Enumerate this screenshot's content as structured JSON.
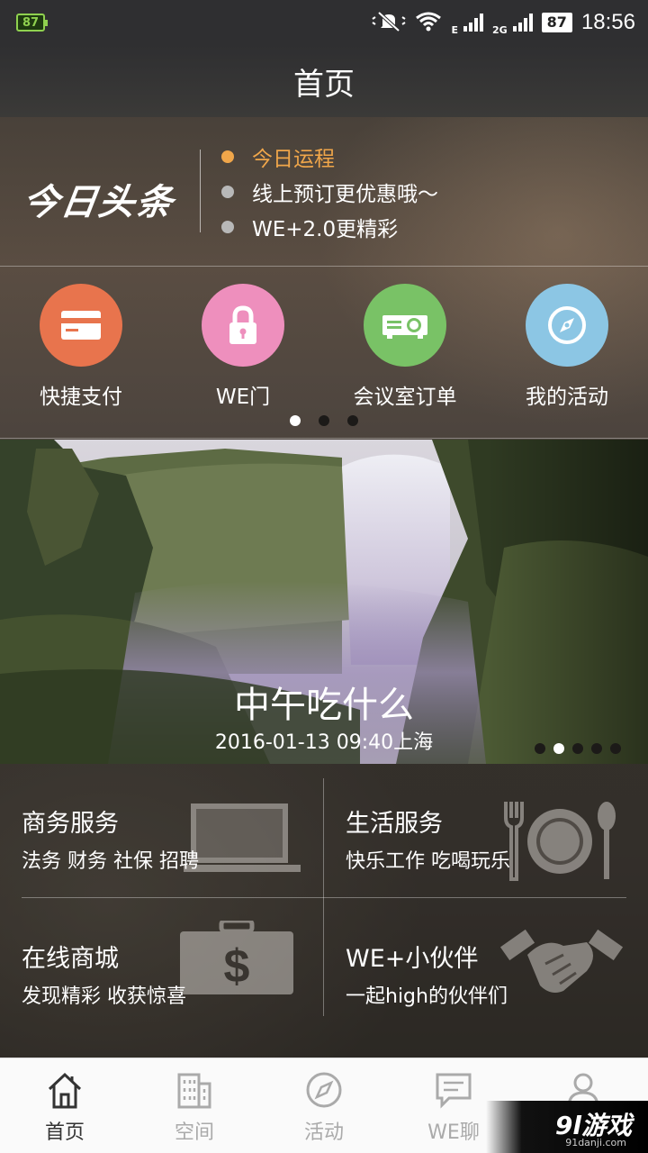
{
  "status_bar": {
    "left_badge": "87",
    "network_1": "E",
    "network_2": "2G",
    "battery": "87",
    "time": "18:56",
    "icons": [
      "battery-saver-icon",
      "mute-icon",
      "wifi-icon",
      "signal-icon",
      "signal-icon"
    ]
  },
  "header": {
    "title": "首页"
  },
  "headline": {
    "logo": "今日头条",
    "items": [
      {
        "label": "今日运程",
        "active": true
      },
      {
        "label": "线上预订更优惠哦～",
        "active": false
      },
      {
        "label": "WE+2.0更精彩",
        "active": false
      }
    ],
    "active_color": "#f0a64a"
  },
  "quick_actions": {
    "items": [
      {
        "label": "快捷支付",
        "icon": "card-icon",
        "color": "#e8744d"
      },
      {
        "label": "WE门",
        "icon": "lock-icon",
        "color": "#ee8fbd"
      },
      {
        "label": "会议室订单",
        "icon": "projector-icon",
        "color": "#79c266"
      },
      {
        "label": "我的活动",
        "icon": "compass-icon",
        "color": "#8cc6e4"
      }
    ],
    "pager": {
      "count": 3,
      "current": 1
    }
  },
  "banner": {
    "title": "中午吃什么",
    "subtitle": "2016-01-13 09:40上海",
    "pager": {
      "count": 5,
      "current": 2
    }
  },
  "services": [
    {
      "title": "商务服务",
      "desc": "法务 财务 社保 招聘",
      "icon": "laptop-icon"
    },
    {
      "title": "生活服务",
      "desc": "快乐工作 吃喝玩乐",
      "icon": "dining-icon"
    },
    {
      "title": "在线商城",
      "desc": "发现精彩 收获惊喜",
      "icon": "money-case-icon"
    },
    {
      "title": "WE+小伙伴",
      "desc": "一起high的伙伴们",
      "icon": "handshake-icon"
    }
  ],
  "bottom_nav": {
    "tabs": [
      {
        "label": "首页",
        "icon": "home-icon",
        "active": true
      },
      {
        "label": "空间",
        "icon": "building-icon",
        "active": false
      },
      {
        "label": "活动",
        "icon": "compass-icon",
        "active": false
      },
      {
        "label": "WE聊",
        "icon": "chat-icon",
        "active": false
      },
      {
        "label": "",
        "icon": "profile-icon",
        "active": false
      }
    ]
  },
  "watermark": {
    "main": "9l游戏",
    "sub": "91danji.com"
  }
}
